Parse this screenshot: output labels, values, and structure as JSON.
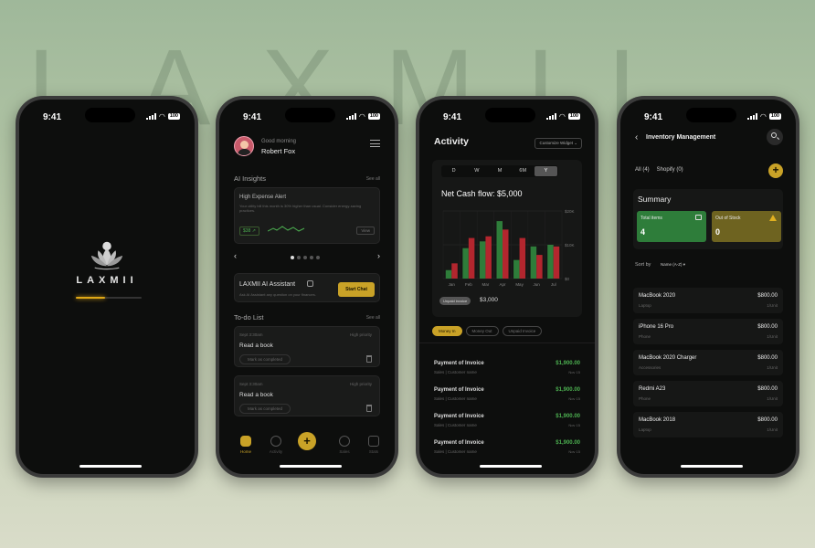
{
  "background": {
    "watermark": "LAXMII",
    "colors": {
      "accent": "#c9a227",
      "green": "#2e7d3a",
      "red": "#b3262e"
    }
  },
  "status": {
    "time": "9:41",
    "battery": "100"
  },
  "splash": {
    "logo_text": "LAXMII",
    "progress": 0.45
  },
  "home": {
    "greeting": "Good morning",
    "user_name": "Robert Fox",
    "ai_insights_label": "AI Insights",
    "see_all": "See all",
    "alert": {
      "title": "High Expense Alert",
      "body": "Your utility bill this month is 30% higher than usual. Consider energy-saving practices.",
      "amount": "$38 ↗",
      "view": "View"
    },
    "carousel": {
      "prev": "‹",
      "next": "›",
      "dots": 5,
      "active": 0
    },
    "assistant": {
      "title": "LAXMII AI Assistant",
      "subtitle": "Ask AI Assistant any question on your finances.",
      "button": "Start Chat"
    },
    "todo_label": "To-do List",
    "todos": [
      {
        "time": "Sept 3:30am",
        "priority": "High priority",
        "title": "Read a book",
        "action": "Mark as completed"
      },
      {
        "time": "Sept 3:30am",
        "priority": "High priority",
        "title": "Read a book",
        "action": "Mark as completed"
      }
    ],
    "tabs": [
      {
        "label": "Home",
        "active": true
      },
      {
        "label": "Activity",
        "active": false
      },
      {
        "label": "Add",
        "active": false
      },
      {
        "label": "Sales",
        "active": false
      },
      {
        "label": "Stats",
        "active": false
      }
    ]
  },
  "activity": {
    "title": "Activity",
    "customize": "Customize Widget ⌄",
    "ranges": [
      "D",
      "W",
      "M",
      "6M",
      "Y"
    ],
    "active_range": "Y",
    "net_cash_flow": "Net Cash flow: $5,000",
    "unpaid_label": "Unpaid invoice",
    "unpaid_amount": "$3,000",
    "filters": [
      {
        "label": "Money In",
        "active": true
      },
      {
        "label": "Money Out",
        "active": false
      },
      {
        "label": "Unpaid Invoice",
        "active": false
      }
    ],
    "transactions": [
      {
        "title": "Payment of Invoice",
        "sub": "Sales | Customer name",
        "amount": "$1,900.00",
        "date": "Nov 15"
      },
      {
        "title": "Payment of Invoice",
        "sub": "Sales | Customer name",
        "amount": "$1,900.00",
        "date": "Nov 15"
      },
      {
        "title": "Payment of Invoice",
        "sub": "Sales | Customer name",
        "amount": "$1,900.00",
        "date": "Nov 15"
      },
      {
        "title": "Payment of Invoice",
        "sub": "Sales | Customer name",
        "amount": "$1,900.00",
        "date": "Nov 15"
      }
    ]
  },
  "chart_data": {
    "type": "bar",
    "title": "Net Cash flow: $5,000",
    "categories": [
      "Jan",
      "Feb",
      "Mar",
      "Apr",
      "May",
      "Jun",
      "Jul"
    ],
    "y_ticks": [
      "$20K",
      "$10K",
      "$0"
    ],
    "ylim": [
      0,
      20000
    ],
    "series": [
      {
        "color": "#2e7d3a",
        "values": [
          2500,
          9000,
          11000,
          17000,
          5500,
          9500,
          10000
        ]
      },
      {
        "color": "#b3262e",
        "values": [
          4500,
          12000,
          12500,
          14500,
          12000,
          7000,
          9500
        ]
      }
    ]
  },
  "inventory": {
    "title": "Inventory Management",
    "tabs": [
      "All (4)",
      "Shopify (0)"
    ],
    "summary_title": "Summary",
    "total_items": {
      "label": "Total items",
      "value": "4",
      "color": "#2e7d3a"
    },
    "out_of_stock": {
      "label": "Out of Stock",
      "value": "0",
      "color": "#7a6a20"
    },
    "sort_label": "Sort by",
    "sort_value": "Name (A-Z) ▾",
    "products": [
      {
        "name": "MacBook 2020",
        "category": "Laptop",
        "price": "$800.00",
        "unit": "1/Unit"
      },
      {
        "name": "iPhone 16 Pro",
        "category": "Phone",
        "price": "$800.00",
        "unit": "1/Unit"
      },
      {
        "name": "MacBook 2020 Charger",
        "category": "Accessories",
        "price": "$800.00",
        "unit": "1/Unit"
      },
      {
        "name": "Redmi A23",
        "category": "Phone",
        "price": "$800.00",
        "unit": "1/Unit"
      },
      {
        "name": "MacBook 2018",
        "category": "Laptop",
        "price": "$800.00",
        "unit": "1/Unit"
      }
    ]
  }
}
